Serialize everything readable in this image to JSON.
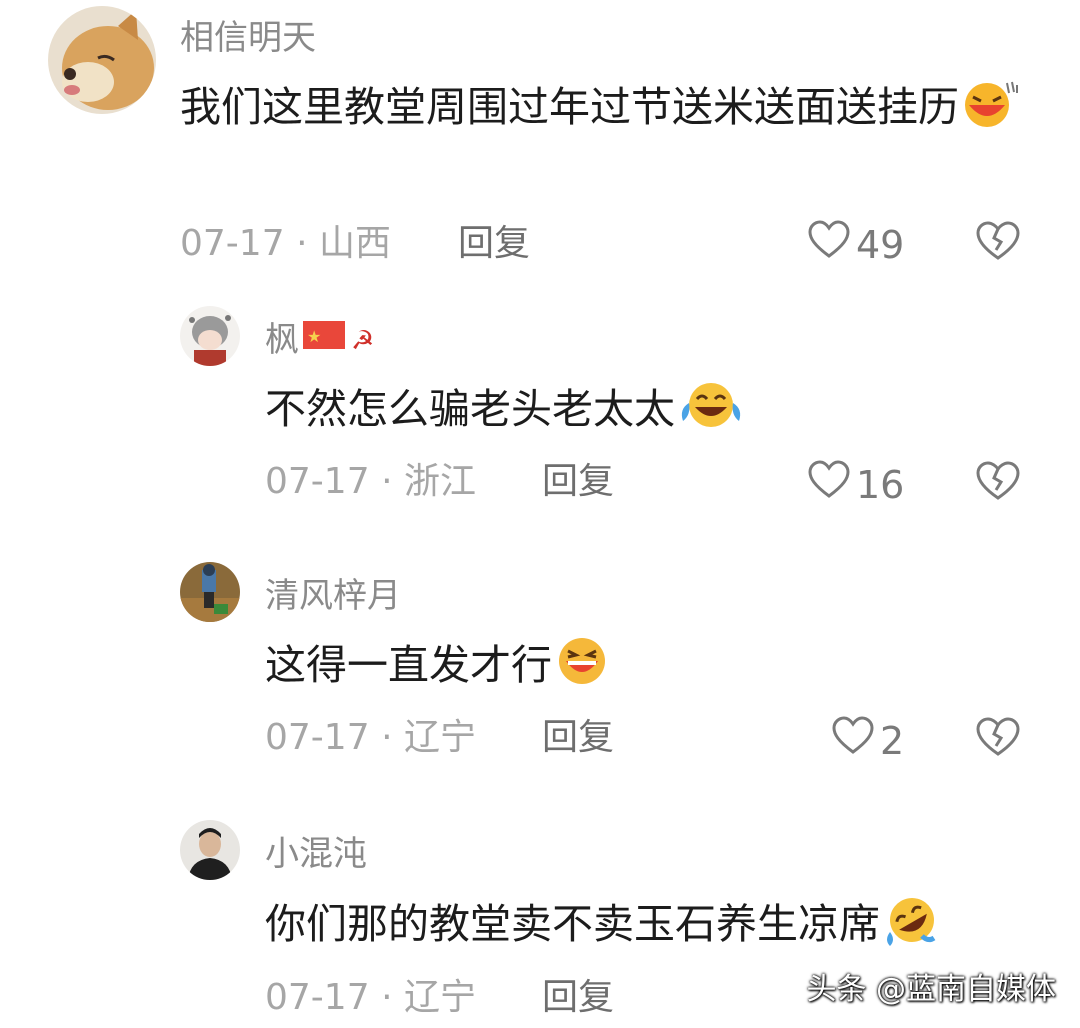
{
  "comments": [
    {
      "username": "相信明天",
      "text": "我们这里教堂周围过年过节送米送面送挂历",
      "date": "07-17",
      "location": "山西",
      "reply_label": "回复",
      "likes": "49",
      "avatar_icon": "dog-avatar"
    },
    {
      "username": "枫",
      "text": "不然怎么骗老头老太太",
      "date": "07-17",
      "location": "浙江",
      "reply_label": "回复",
      "likes": "16",
      "avatar_icon": "anime-avatar"
    },
    {
      "username": "清风梓月",
      "text": "这得一直发才行",
      "date": "07-17",
      "location": "辽宁",
      "reply_label": "回复",
      "likes": "2",
      "avatar_icon": "figure-avatar"
    },
    {
      "username": "小混沌",
      "text": "你们那的教堂卖不卖玉石养生凉席",
      "date": "07-17",
      "location": "辽宁",
      "reply_label": "回复",
      "likes": "",
      "avatar_icon": "person-avatar"
    }
  ],
  "meta_separator": "·",
  "watermark": "头条 @蓝南自媒体",
  "colors": {
    "username": "#8a8a8a",
    "text": "#1c1c1c",
    "meta": "#a6a6a6"
  }
}
